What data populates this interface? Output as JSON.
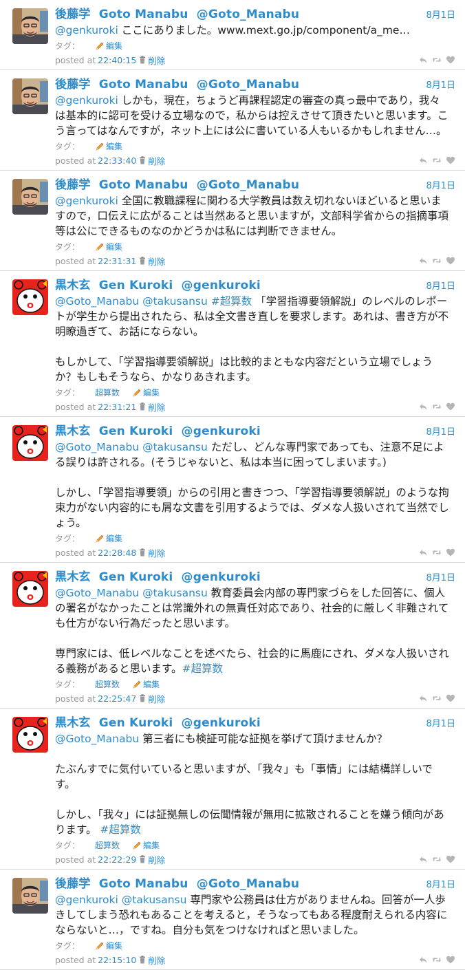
{
  "labels": {
    "tags": "タグ：",
    "edit": "編集",
    "posted_at": "posted at",
    "delete": "削除"
  },
  "tweets": [
    {
      "author": "goto",
      "name_jp": "後藤学",
      "name_en": "Goto Manabu",
      "handle": "@Goto_Manabu",
      "date": "8月1日",
      "segments": [
        [
          {
            "t": "m",
            "v": "@genkuroki"
          },
          {
            "t": "x",
            "v": " ここにありました。www.mext.go.jp/component/a_me…"
          }
        ]
      ],
      "tags": [],
      "time": "22:40:15"
    },
    {
      "author": "goto",
      "name_jp": "後藤学",
      "name_en": "Goto Manabu",
      "handle": "@Goto_Manabu",
      "date": "8月1日",
      "segments": [
        [
          {
            "t": "m",
            "v": "@genkuroki"
          },
          {
            "t": "x",
            "v": " しかも，現在，ちょうど再課程認定の審査の真っ最中であり，我々は基本的に認可を受ける立場なので，私からは控えさせて頂きたいと思います。こう言ってはなんですが，ネット上には公に書いている人もいるかもしれません…。"
          }
        ]
      ],
      "tags": [],
      "time": "22:33:40"
    },
    {
      "author": "goto",
      "name_jp": "後藤学",
      "name_en": "Goto Manabu",
      "handle": "@Goto_Manabu",
      "date": "8月1日",
      "segments": [
        [
          {
            "t": "m",
            "v": "@genkuroki"
          },
          {
            "t": "x",
            "v": " 全国に教職課程に関わる大学教員は数え切れないほどいると思いますので，口伝えに広がることは当然あると思いますが，文部科学省からの指摘事項等は公にできるものなのかどうかは私には判断できません。"
          }
        ]
      ],
      "tags": [],
      "time": "22:31:31"
    },
    {
      "author": "kuroki",
      "name_jp": "黒木玄",
      "name_en": "Gen Kuroki",
      "handle": "@genkuroki",
      "date": "8月1日",
      "segments": [
        [
          {
            "t": "m",
            "v": "@Goto_Manabu"
          },
          {
            "t": "x",
            "v": " "
          },
          {
            "t": "m",
            "v": "@takusansu"
          },
          {
            "t": "x",
            "v": " "
          },
          {
            "t": "h",
            "v": "#超算数"
          },
          {
            "t": "x",
            "v": " 「学習指導要領解説」のレベルのレポートが学生から提出されたら、私は全文書き直しを要求します。あれは、書き方が不明瞭過ぎて、お話にならない。"
          }
        ],
        [
          {
            "t": "x",
            "v": "もしかして、「学習指導要領解説」は比較的まともな内容だという立場でしょうか？もしもそうなら、かなりあきれます。"
          }
        ]
      ],
      "tags": [
        "超算数"
      ],
      "time": "22:31:21"
    },
    {
      "author": "kuroki",
      "name_jp": "黒木玄",
      "name_en": "Gen Kuroki",
      "handle": "@genkuroki",
      "date": "8月1日",
      "segments": [
        [
          {
            "t": "m",
            "v": "@Goto_Manabu"
          },
          {
            "t": "x",
            "v": " "
          },
          {
            "t": "m",
            "v": "@takusansu"
          },
          {
            "t": "x",
            "v": " ただし、どんな専門家であっても、注意不足による誤りは許される。(そうじゃないと、私は本当に困ってしまいます。)"
          }
        ],
        [
          {
            "t": "x",
            "v": "しかし、「学習指導要領」からの引用と書きつつ、「学習指導要領解説」のような拘束力がない内容的にも屑な文書を引用するようでは、ダメな人扱いされて当然でしょう。"
          }
        ]
      ],
      "tags": [],
      "time": "22:28:48"
    },
    {
      "author": "kuroki",
      "name_jp": "黒木玄",
      "name_en": "Gen Kuroki",
      "handle": "@genkuroki",
      "date": "8月1日",
      "segments": [
        [
          {
            "t": "m",
            "v": "@Goto_Manabu"
          },
          {
            "t": "x",
            "v": " "
          },
          {
            "t": "m",
            "v": "@takusansu"
          },
          {
            "t": "x",
            "v": " 教育委員会内部の専門家づらをした回答に、個人の署名がなかったことは常識外れの無責任対応であり、社会的に厳しく非難されても仕方がない行為だったと思います。"
          }
        ],
        [
          {
            "t": "x",
            "v": "専門家には、低レベルなことを述べたら、社会的に馬鹿にされ、ダメな人扱いされる義務があると思います。"
          },
          {
            "t": "h",
            "v": "#超算数"
          }
        ]
      ],
      "tags": [
        "超算数"
      ],
      "time": "22:25:47"
    },
    {
      "author": "kuroki",
      "name_jp": "黒木玄",
      "name_en": "Gen Kuroki",
      "handle": "@genkuroki",
      "date": "8月1日",
      "segments": [
        [
          {
            "t": "m",
            "v": "@Goto_Manabu"
          },
          {
            "t": "x",
            "v": " 第三者にも検証可能な証拠を挙げて頂けませんか？"
          }
        ],
        [
          {
            "t": "x",
            "v": "たぶんすでに気付いていると思いますが、「我々」も「事情」には結構詳しいです。"
          }
        ],
        [
          {
            "t": "x",
            "v": "しかし、「我々」には証拠無しの伝聞情報が無用に拡散されることを嫌う傾向があります。 "
          },
          {
            "t": "h",
            "v": "#超算数"
          }
        ]
      ],
      "tags": [
        "超算数"
      ],
      "time": "22:22:29"
    },
    {
      "author": "goto",
      "name_jp": "後藤学",
      "name_en": "Goto Manabu",
      "handle": "@Goto_Manabu",
      "date": "8月1日",
      "segments": [
        [
          {
            "t": "m",
            "v": "@genkuroki"
          },
          {
            "t": "x",
            "v": " "
          },
          {
            "t": "m",
            "v": "@takusansu"
          },
          {
            "t": "x",
            "v": " 専門家や公務員は仕方がありませんね。回答が一人歩きしてしまう恐れもあることを考えると，そうなってもある程度耐えられる内容にならないと…，ですね。自分も気をつけなければと思いました。"
          }
        ]
      ],
      "tags": [],
      "time": "22:15:10"
    }
  ],
  "colors": {
    "link": "#2d8ccc",
    "meta": "#999999",
    "kuroki_avatar": "#e8231e"
  },
  "icons": {
    "edit": "pencil-icon",
    "delete": "trash-icon",
    "reply": "reply-icon",
    "retweet": "retweet-icon",
    "favorite": "heart-icon"
  }
}
